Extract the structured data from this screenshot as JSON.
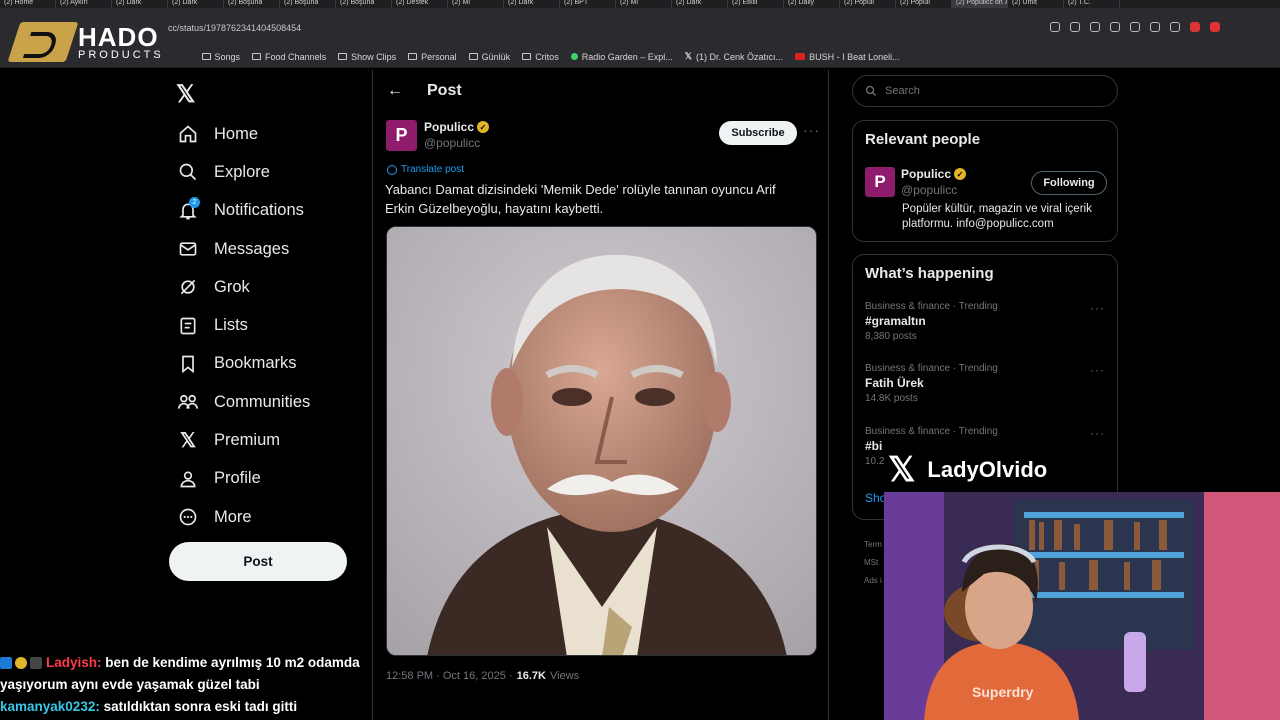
{
  "browser": {
    "tabs": [
      "(2) Home",
      "(2) Aykırı",
      "(2) Dark",
      "(2) Dark",
      "(2) Boşuna",
      "(2) Boşuna",
      "(2) Boşuna",
      "(2) Destek",
      "(2) Mi",
      "(2) Dark",
      "(2) BPT",
      "(2) Mi",
      "(2) Dark",
      "(2) Etkili",
      "(2) Daily",
      "(2) Populi",
      "(2) Populi",
      "(2) Populicc on X",
      "(2) Ümit",
      "(2) T.C."
    ],
    "url": "cc/status/1978762341404508454",
    "bookmarks": [
      "Re",
      "Songs",
      "Food Channels",
      "Show Clips",
      "Personal",
      "Günlük",
      "Critos",
      "Radio Garden – Expl...",
      "(1) Dr. Cenk Özatıcı...",
      "BUSH - I Beat Loneli..."
    ]
  },
  "overlay_logo": {
    "title": "HADO",
    "subtitle": "PRODUCTS"
  },
  "nav": {
    "items": [
      {
        "label": "Home",
        "icon": "home-icon"
      },
      {
        "label": "Explore",
        "icon": "search-icon"
      },
      {
        "label": "Notifications",
        "icon": "bell-icon",
        "badge": "2"
      },
      {
        "label": "Messages",
        "icon": "envelope-icon"
      },
      {
        "label": "Grok",
        "icon": "grok-icon"
      },
      {
        "label": "Lists",
        "icon": "list-icon"
      },
      {
        "label": "Bookmarks",
        "icon": "bookmark-icon"
      },
      {
        "label": "Communities",
        "icon": "communities-icon"
      },
      {
        "label": "Premium",
        "icon": "x-icon"
      },
      {
        "label": "Profile",
        "icon": "person-icon"
      },
      {
        "label": "More",
        "icon": "more-circle-icon"
      }
    ],
    "post_button": "Post"
  },
  "post": {
    "header_title": "Post",
    "author_name": "Populicc",
    "author_handle": "@populicc",
    "avatar_letter": "P",
    "subscribe_label": "Subscribe",
    "translate_label": "Translate post",
    "text": "Yabancı Damat dizisindeki 'Memik Dede' rolüyle tanınan oyuncu Arif Erkin Güzelbeyoğlu, hayatını kaybetti.",
    "time": "12:58 PM · Oct 16, 2025 ·",
    "views_count": "16.7K",
    "views_label": "Views"
  },
  "sidebar": {
    "search_placeholder": "Search",
    "relevant_title": "Relevant people",
    "relevant_person": {
      "name": "Populicc",
      "handle": "@populicc",
      "follow_label": "Following",
      "bio": "Popüler kültür, magazin ve viral içerik platformu. info@populicc.com"
    },
    "happening_title": "What’s happening",
    "trends": [
      {
        "category": "Business & finance · Trending",
        "name": "#gramaltın",
        "count": "8,380 posts"
      },
      {
        "category": "Business & finance · Trending",
        "name": "Fatih Ürek",
        "count": "14.8K posts"
      },
      {
        "category": "Business & finance · Trending",
        "name": "#bi",
        "count": "10.2"
      }
    ],
    "show_more": "Sho",
    "footer": [
      "Term",
      "MSt",
      "Ads i"
    ]
  },
  "webcam": {
    "name": "LadyOlvido"
  },
  "chat": [
    {
      "user": "Ladyish:",
      "message": "ben de kendime ayrılmış 10 m2 odamda yaşıyorum aynı evde yaşamak güzel tabi"
    },
    {
      "user": "kamanyak0232:",
      "message": "satıldıktan sonra eski tadı gitti"
    }
  ],
  "colors": {
    "accent": "#1d9bf0",
    "brand_populicc": "#8e1b6b",
    "verified": "#e0b52c"
  }
}
